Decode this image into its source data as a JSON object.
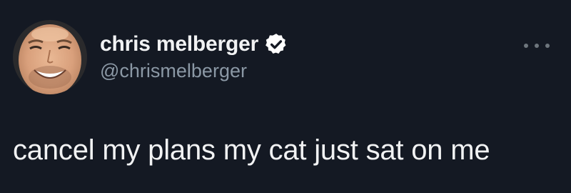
{
  "tweet": {
    "author": {
      "display_name": "chris melberger",
      "handle": "@chrismelberger",
      "verified": true,
      "avatar_icon": "profile-photo"
    },
    "text": "cancel my plans my cat just sat on me",
    "more_icon": "more-horizontal-icon"
  },
  "colors": {
    "background": "#141923",
    "primary_text": "#f1f2f3",
    "secondary_text": "#8b98a5",
    "verified_badge": "#ffffff"
  }
}
